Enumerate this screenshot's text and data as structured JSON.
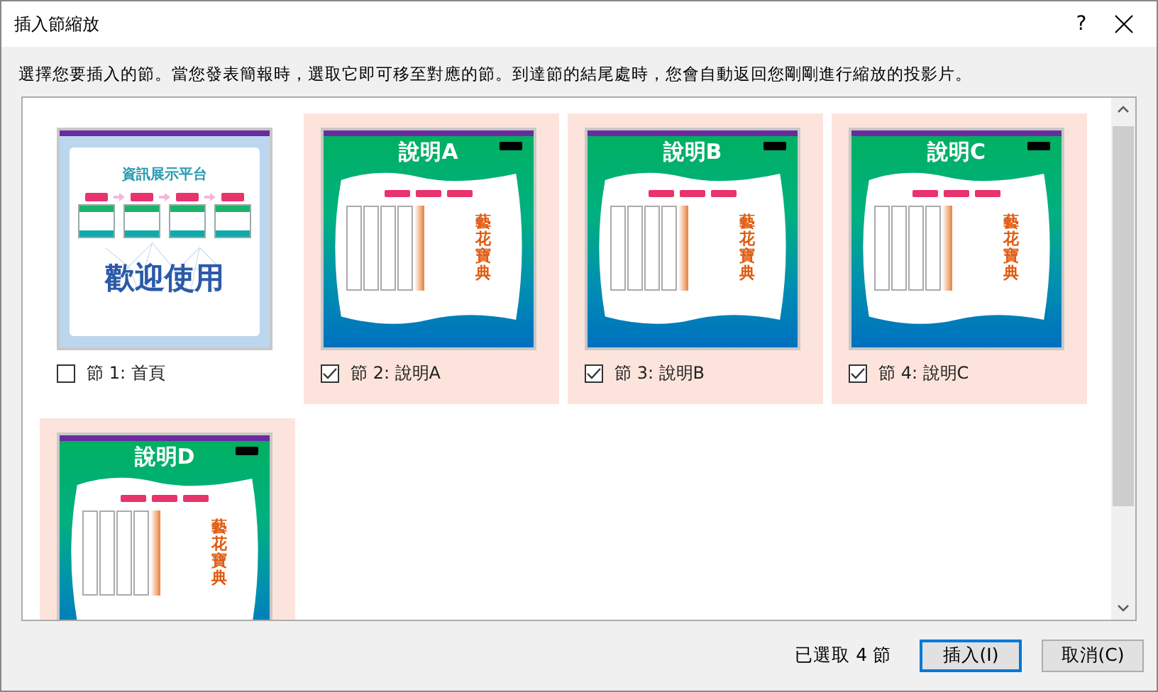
{
  "window": {
    "title": "插入節縮放",
    "help": "?"
  },
  "instruction": "選擇您要插入的節。當您發表簡報時，選取它即可移至對應的節。到達節的結尾處時，您會自動返回您剛剛進行縮放的投影片。",
  "sections": [
    {
      "kind": "home",
      "label": "節 1: 首頁",
      "checked": false,
      "title": "資訊展示平台",
      "text": "歡迎使用"
    },
    {
      "kind": "content",
      "label": "節 2: 說明A",
      "checked": true,
      "title": "說明A",
      "text": "藝花寶典"
    },
    {
      "kind": "content",
      "label": "節 3: 說明B",
      "checked": true,
      "title": "說明B",
      "text": "藝花寶典"
    },
    {
      "kind": "content",
      "label": "節 4: 說明C",
      "checked": true,
      "title": "說明C",
      "text": "藝花寶典"
    },
    {
      "kind": "content",
      "checked": true,
      "title": "說明D",
      "text": "藝花寶典"
    }
  ],
  "status": "已選取 4 節",
  "buttons": [
    {
      "label": "插入(I)",
      "default": true
    },
    {
      "label": "取消(C)",
      "default": false
    }
  ]
}
